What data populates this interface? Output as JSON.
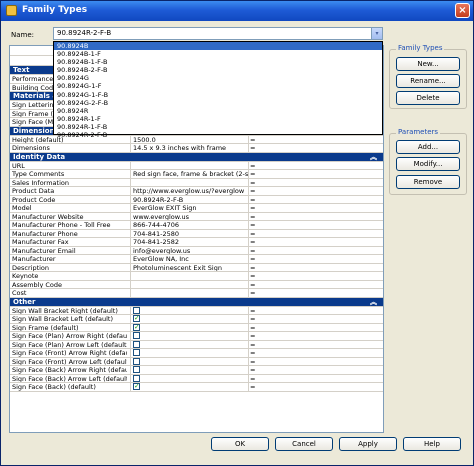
{
  "window": {
    "title": "Family Types",
    "close": "×"
  },
  "name_field": {
    "label": "Name:",
    "value": "90.8924R-2-F-B",
    "arrow": "▾"
  },
  "dropdown_items": [
    {
      "label": "90.8924B",
      "selected": true
    },
    {
      "label": "90.8924B-1-F"
    },
    {
      "label": "90.8924B-1-F-B"
    },
    {
      "label": "90.8924B-2-F-B"
    },
    {
      "label": "90.8924G"
    },
    {
      "label": "90.8924G-1-F"
    },
    {
      "label": "90.8924G-1-F-B"
    },
    {
      "label": "90.8924G-2-F-B"
    },
    {
      "label": "90.8924R"
    },
    {
      "label": "90.8924R-1-F"
    },
    {
      "label": "90.8924R-1-F-B"
    },
    {
      "label": "90.8924R-2-F-B"
    }
  ],
  "family_types_group": {
    "label": "Family Types",
    "new": "New...",
    "rename": "Rename...",
    "delete": "Delete"
  },
  "parameters_group": {
    "label": "Parameters",
    "add": "Add...",
    "modify": "Modify...",
    "remove": "Remove"
  },
  "grid": {
    "text_section": {
      "label": "Text"
    },
    "text_rows": [
      {
        "name": "Performance",
        "value": "",
        "formula": "="
      },
      {
        "name": "Building Code",
        "value": "",
        "formula": "="
      }
    ],
    "materials_section": {
      "label": "Materials an"
    },
    "materials_rows": [
      {
        "name": "Sign Lettering",
        "value": "",
        "formula": "="
      },
      {
        "name": "Sign Frame (M",
        "value": "",
        "formula": "="
      },
      {
        "name": "Sign Face (Ma",
        "value": "",
        "formula": "="
      }
    ],
    "dimensions_section": {
      "label": "Dimensions"
    },
    "dimensions_rows": [
      {
        "name": "Height (default)",
        "value": "1500.0",
        "formula": "="
      },
      {
        "name": "Dimensions",
        "value": "14.5 x 9.3 inches with frame",
        "formula": "="
      }
    ],
    "identity_section": {
      "label": "Identity Data",
      "chevron": "︽"
    },
    "identity_rows": [
      {
        "name": "URL",
        "value": "",
        "formula": "="
      },
      {
        "name": "Type Comments",
        "value": "Red sign face, frame & bracket (2-side,",
        "formula": "="
      },
      {
        "name": "Sales Information",
        "value": "",
        "formula": "="
      },
      {
        "name": "Product Data",
        "value": "http://www.everglow.us/?everglow",
        "formula": "="
      },
      {
        "name": "Product Code",
        "value": "90.8924R-2-F-B",
        "formula": "="
      },
      {
        "name": "Model",
        "value": "EverGlow EXIT Sign",
        "formula": "="
      },
      {
        "name": "Manufacturer Website",
        "value": "www.everglow.us",
        "formula": "="
      },
      {
        "name": "Manufacturer Phone - Toll Free",
        "value": "866-744-4706",
        "formula": "="
      },
      {
        "name": "Manufacturer Phone",
        "value": "704-841-2580",
        "formula": "="
      },
      {
        "name": "Manufacturer Fax",
        "value": "704-841-2582",
        "formula": "="
      },
      {
        "name": "Manufacturer Email",
        "value": "info@everglow.us",
        "formula": "="
      },
      {
        "name": "Manufacturer",
        "value": "EverGlow NA, Inc",
        "formula": "="
      },
      {
        "name": "Description",
        "value": "Photoluminescent Exit Sign",
        "formula": "="
      },
      {
        "name": "Keynote",
        "value": "",
        "formula": "="
      },
      {
        "name": "Assembly Code",
        "value": "",
        "formula": "="
      },
      {
        "name": "Cost",
        "value": "",
        "formula": "="
      }
    ],
    "other_section": {
      "label": "Other",
      "chevron": "︽"
    },
    "other_rows": [
      {
        "name": "Sign Wall Bracket Right (default)",
        "checked": false,
        "formula": "="
      },
      {
        "name": "Sign Wall Bracket Left (default)",
        "checked": true,
        "formula": "="
      },
      {
        "name": "Sign Frame (default)",
        "checked": true,
        "formula": "="
      },
      {
        "name": "Sign Face (Plan) Arrow Right (default)",
        "checked": false,
        "formula": "="
      },
      {
        "name": "Sign Face (Plan) Arrow Left (default)",
        "checked": false,
        "formula": "="
      },
      {
        "name": "Sign Face (Front) Arrow Right (default)",
        "checked": false,
        "formula": "="
      },
      {
        "name": "Sign Face (Front) Arrow Left (default)",
        "checked": false,
        "formula": "="
      },
      {
        "name": "Sign Face (Back) Arrow Right (default)",
        "checked": false,
        "formula": "="
      },
      {
        "name": "Sign Face (Back) Arrow Left (default)",
        "checked": false,
        "formula": "="
      },
      {
        "name": "Sign Face (Back) (default)",
        "checked": true,
        "formula": "="
      }
    ]
  },
  "footer": {
    "ok": "OK",
    "cancel": "Cancel",
    "apply": "Apply",
    "help": "Help"
  },
  "colors": {
    "title_bar": "#1e5bd6",
    "section_header": "#0a3a8c",
    "selection": "#316ac5",
    "dialog_bg": "#ece9d8"
  }
}
